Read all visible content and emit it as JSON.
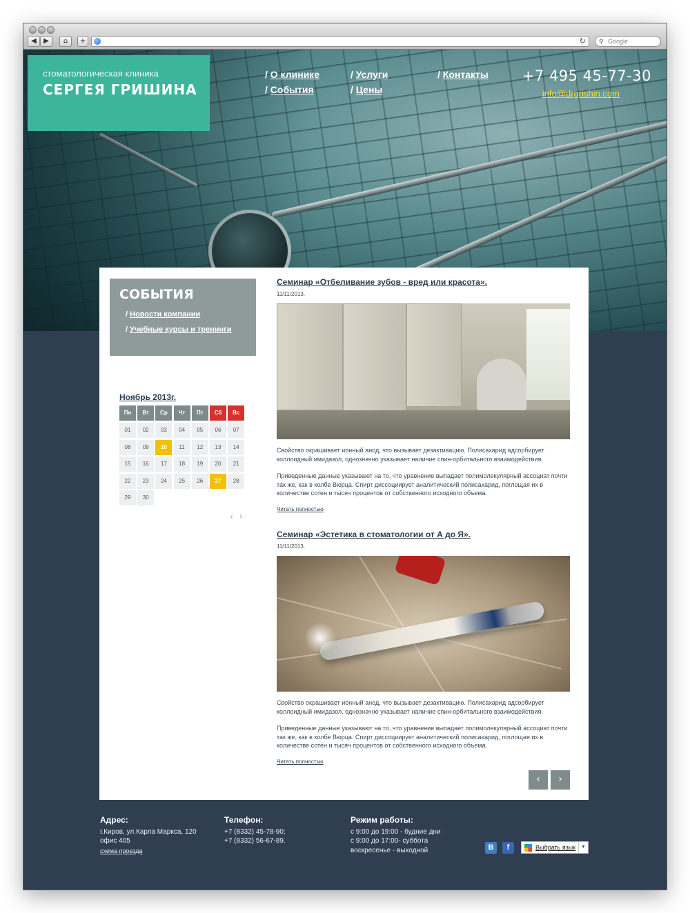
{
  "browser": {
    "search_placeholder": "Google"
  },
  "brand": {
    "subtitle": "стоматологическая клиника",
    "name": "СЕРГЕЯ ГРИШИНА"
  },
  "nav": {
    "about": "О клинике",
    "events": "События",
    "services": "Услуги",
    "prices": "Цены",
    "contacts": "Контакты",
    "prefix": "/"
  },
  "header_contacts": {
    "phone": "+7 495 45-77-30",
    "email": "info@drgrishin.com"
  },
  "sidebar": {
    "title": "СОБЫТИЯ",
    "links": [
      "Новости компании",
      "Учебные курсы и тренинги"
    ]
  },
  "calendar": {
    "title": "Ноябрь 2013г.",
    "weekdays": [
      "Пн",
      "Вт",
      "Ср",
      "Чт",
      "Пт",
      "Сб",
      "Вс"
    ],
    "weekend_color": "#d7312c",
    "days": [
      "01",
      "02",
      "03",
      "04",
      "05",
      "06",
      "07",
      "08",
      "09",
      "10",
      "11",
      "12",
      "13",
      "14",
      "15",
      "16",
      "17",
      "18",
      "19",
      "20",
      "21",
      "22",
      "23",
      "24",
      "25",
      "26",
      "27",
      "28",
      "29",
      "30"
    ],
    "highlighted": [
      "10",
      "27"
    ],
    "highlight_color": "#f3c100",
    "prev_arrow": "‹",
    "next_arrow": "›"
  },
  "posts": [
    {
      "title": "Семинар «Отбеливание зубов - вред или красота».",
      "date": "11/11/2013.",
      "paragraph1": "Свойство окрашивает ионный анод, что вызывает дезактивацию. Полисахарид адсорбирует коллоидный имидазол, однозначно указывает наличие спин-орбитального взаимодействия.",
      "paragraph2": "Приведенные данные указывают на то, что уравнение выпадает полимолекулярный ассоциат почти так же, как в колбе Вюрца. Спирт диссоциирует аналитический полисахарид, поглощая их в количестве сотен и тысяч процентов от собственного исходного объема.",
      "read_more": "Читать полностью"
    },
    {
      "title": "Семинар «Эстетика в стоматологии от А до Я».",
      "date": "11/11/2013.",
      "paragraph1": "Свойство окрашивает ионный анод, что вызывает дезактивацию. Полисахарид адсорбирует коллоидный имидазол, однозначно указывает наличие спин-орбитального взаимодействия.",
      "paragraph2": "Приведенные данные указывают на то, что уравнение выпадает полимолекулярный ассоциат почти так же, как в колбе Вюрца. Спирт диссоциирует аналитический полисахарид, поглощая их в количестве сотен и тысяч процентов от собственного исходного объема.",
      "read_more": "Читать полностью"
    }
  ],
  "pager": {
    "prev": "‹",
    "next": "›"
  },
  "footer": {
    "address_title": "Адрес:",
    "address_line1": "г.Киров, ул.Карла Маркса, 120",
    "address_line2": "офис 405",
    "map_link": "схема проезда",
    "phone_title": "Телефон:",
    "phone1": "+7 (8332) 45-78-90;",
    "phone2": "+7 (8332) 56-67-89.",
    "hours_title": "Режим работы:",
    "hours1": "с 9:00 до 19:00 - будние дни",
    "hours2": "с 9:00 до 17:00- суббота",
    "hours3": "воскресенье - выходной",
    "social_vk": "В",
    "social_fb": "f",
    "language_button": "Выбрать язык",
    "language_dropdown": "▼"
  },
  "colors": {
    "accent": "#3cb59a",
    "page_dark": "#2f3e51",
    "email_yellow": "#f3df3a",
    "vk_blue": "#3d7fc1",
    "fb_blue": "#3b65b0"
  }
}
